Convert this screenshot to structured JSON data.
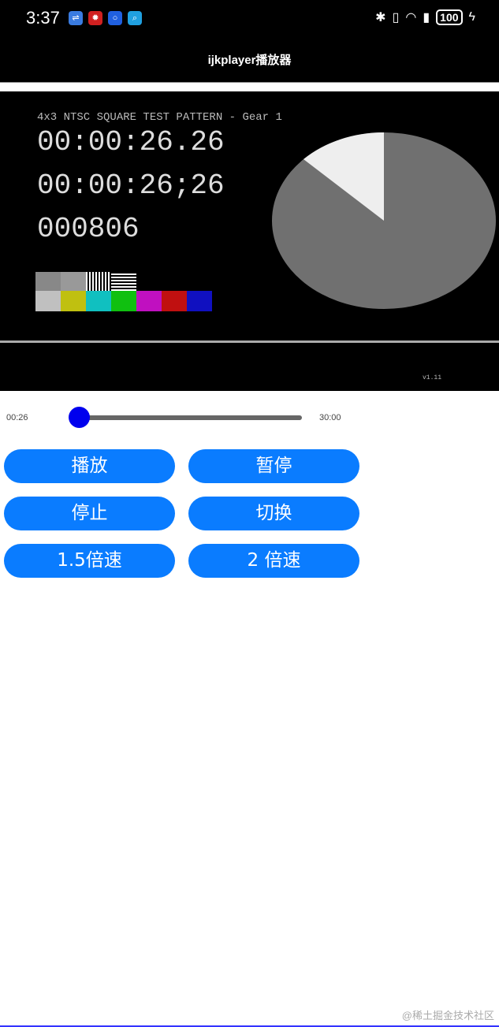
{
  "status_bar": {
    "time": "3:37",
    "battery": "100",
    "notif_icons": [
      "usb-icon",
      "app-icon",
      "bulb-icon",
      "search-icon"
    ]
  },
  "header": {
    "title": "ijkplayer播放器"
  },
  "video": {
    "pattern_title": "4x3 NTSC SQUARE TEST PATTERN - Gear 1",
    "timecode1": "00:00:26.26",
    "timecode2": "00:00:26;26",
    "frame": "000806",
    "version": "v1.11",
    "colors": [
      "#c0c0c0",
      "#c0c010",
      "#10c0c0",
      "#10c010",
      "#c010c0",
      "#c01010",
      "#1010c0"
    ]
  },
  "player": {
    "current_time": "00:26",
    "total_time": "30:00",
    "progress": 0.014
  },
  "buttons": {
    "play": "播放",
    "pause": "暂停",
    "stop": "停止",
    "switch": "切换",
    "speed15": "1.5倍速",
    "speed2": "2 倍速"
  },
  "watermark": "@稀土掘金技术社区"
}
